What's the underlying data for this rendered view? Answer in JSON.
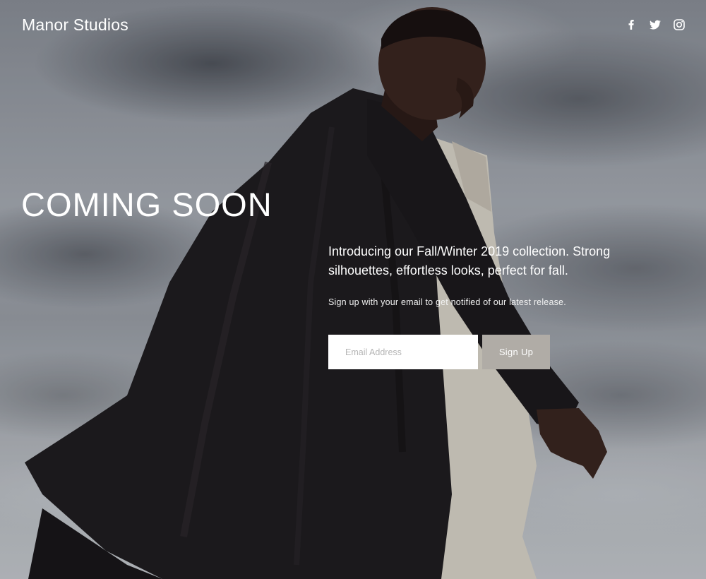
{
  "header": {
    "brand": "Manor Studios",
    "social": [
      {
        "name": "facebook-icon"
      },
      {
        "name": "twitter-icon"
      },
      {
        "name": "instagram-icon"
      }
    ]
  },
  "hero": {
    "headline": "COMING SOON",
    "intro": "Introducing our Fall/Winter 2019 collection. Strong silhouettes, effortless looks, perfect for fall.",
    "note": "Sign up with your email to get notified of our latest release."
  },
  "form": {
    "email_placeholder": "Email Address",
    "email_value": "",
    "submit_label": "Sign Up"
  },
  "colors": {
    "text": "#ffffff",
    "button_bg": "#b0aca6",
    "input_bg": "#ffffff",
    "placeholder": "#b5b5b5"
  }
}
